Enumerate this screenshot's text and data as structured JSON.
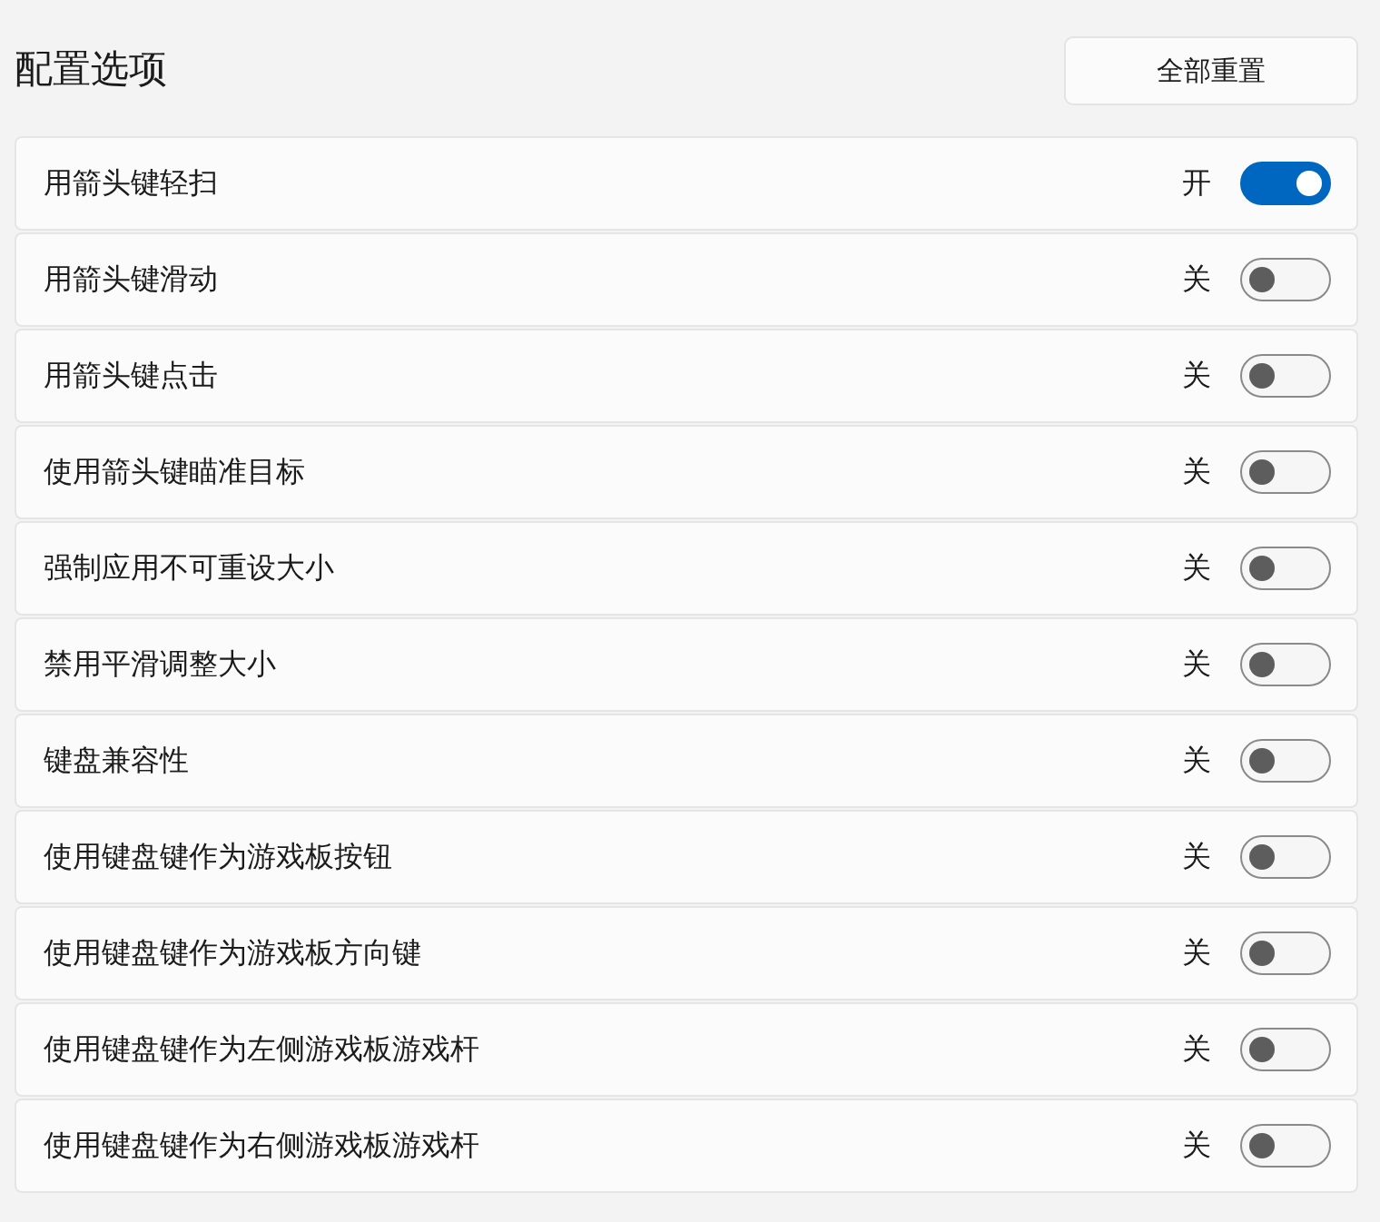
{
  "title": "配置选项",
  "reset_button": "全部重置",
  "options": [
    {
      "label": "用箭头键轻扫",
      "state": "开",
      "on": true
    },
    {
      "label": "用箭头键滑动",
      "state": "关",
      "on": false
    },
    {
      "label": "用箭头键点击",
      "state": "关",
      "on": false
    },
    {
      "label": "使用箭头键瞄准目标",
      "state": "关",
      "on": false
    },
    {
      "label": "强制应用不可重设大小",
      "state": "关",
      "on": false
    },
    {
      "label": "禁用平滑调整大小",
      "state": "关",
      "on": false
    },
    {
      "label": "键盘兼容性",
      "state": "关",
      "on": false
    },
    {
      "label": "使用键盘键作为游戏板按钮",
      "state": "关",
      "on": false
    },
    {
      "label": "使用键盘键作为游戏板方向键",
      "state": "关",
      "on": false
    },
    {
      "label": "使用键盘键作为左侧游戏板游戏杆",
      "state": "关",
      "on": false
    },
    {
      "label": "使用键盘键作为右侧游戏板游戏杆",
      "state": "关",
      "on": false
    }
  ]
}
